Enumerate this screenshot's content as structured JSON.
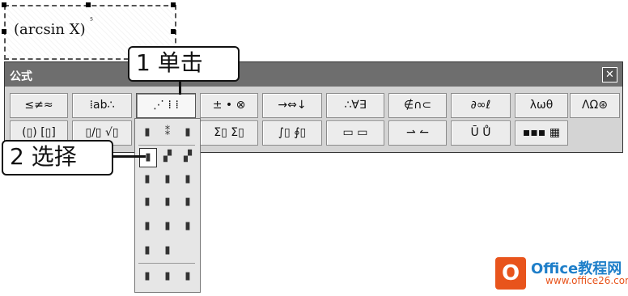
{
  "equation": {
    "text": "(arcsin X)",
    "caret": "⁵"
  },
  "toolbar": {
    "title": "公式",
    "close_label": "✕",
    "row1": [
      {
        "label": "≤≠≈"
      },
      {
        "label": "⁞ab∴"
      },
      {
        "label": "⋰ ⁞ ⁞"
      },
      {
        "label": "± • ⊗"
      },
      {
        "label": "→⇔↓"
      },
      {
        "label": "∴∀∃"
      },
      {
        "label": "∉∩⊂"
      },
      {
        "label": "∂∞ℓ"
      },
      {
        "label": "λωθ"
      },
      {
        "label": "ΛΩ⊛"
      }
    ],
    "row2": [
      {
        "label": "(▯) [▯]"
      },
      {
        "label": "▯/▯ √▯"
      },
      {
        "label": "▯ ▯"
      },
      {
        "label": "Σ▯ Σ▯"
      },
      {
        "label": "∫▯ ∮▯"
      },
      {
        "label": "▭ ▭"
      },
      {
        "label": "⇀ ↼"
      },
      {
        "label": "Ū Ů"
      },
      {
        "label": "▪▪▪ ▦"
      }
    ]
  },
  "dropdown": {
    "rows": [
      [
        "▮",
        "⁑",
        "▮"
      ],
      [
        "▮",
        "▞",
        "▞"
      ],
      [
        "▮",
        "▮",
        "▮"
      ],
      [
        "▮",
        "▮",
        "▮"
      ],
      [
        "▮",
        "▮",
        "▮"
      ],
      [
        "▮",
        "▮",
        ""
      ],
      [
        "▮",
        "▮",
        "▮"
      ]
    ]
  },
  "callouts": {
    "step1": "1 单击",
    "step2": "2 选择"
  },
  "watermark": {
    "brand": "Office教程网",
    "url": "www.office26.com"
  }
}
